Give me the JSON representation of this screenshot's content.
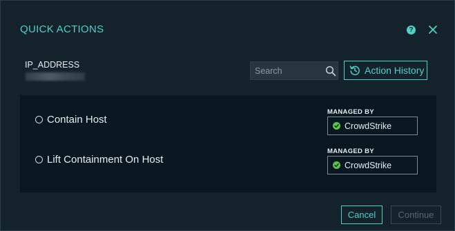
{
  "dialog": {
    "title": "QUICK ACTIONS",
    "help_icon": "question-circle-icon",
    "help_text": "?",
    "close_icon": "close-icon"
  },
  "target": {
    "label": "IP_ADDRESS",
    "value_redacted": true
  },
  "search": {
    "placeholder": "Search",
    "value": "",
    "icon": "search-icon"
  },
  "history": {
    "label": "Action History",
    "icon": "history-icon"
  },
  "actions": [
    {
      "label": "Contain Host",
      "selected": false,
      "managed_by_label": "MANAGED BY",
      "managed_by": "CrowdStrike",
      "status_icon": "check-circle-icon"
    },
    {
      "label": "Lift Containment On Host",
      "selected": false,
      "managed_by_label": "MANAGED BY",
      "managed_by": "CrowdStrike",
      "status_icon": "check-circle-icon"
    }
  ],
  "footer": {
    "cancel_label": "Cancel",
    "continue_label": "Continue",
    "continue_enabled": false
  },
  "colors": {
    "accent": "#4fd1c5",
    "success": "#58c44a",
    "panel_bg": "#0a1720",
    "dialog_bg": "#14222c"
  }
}
